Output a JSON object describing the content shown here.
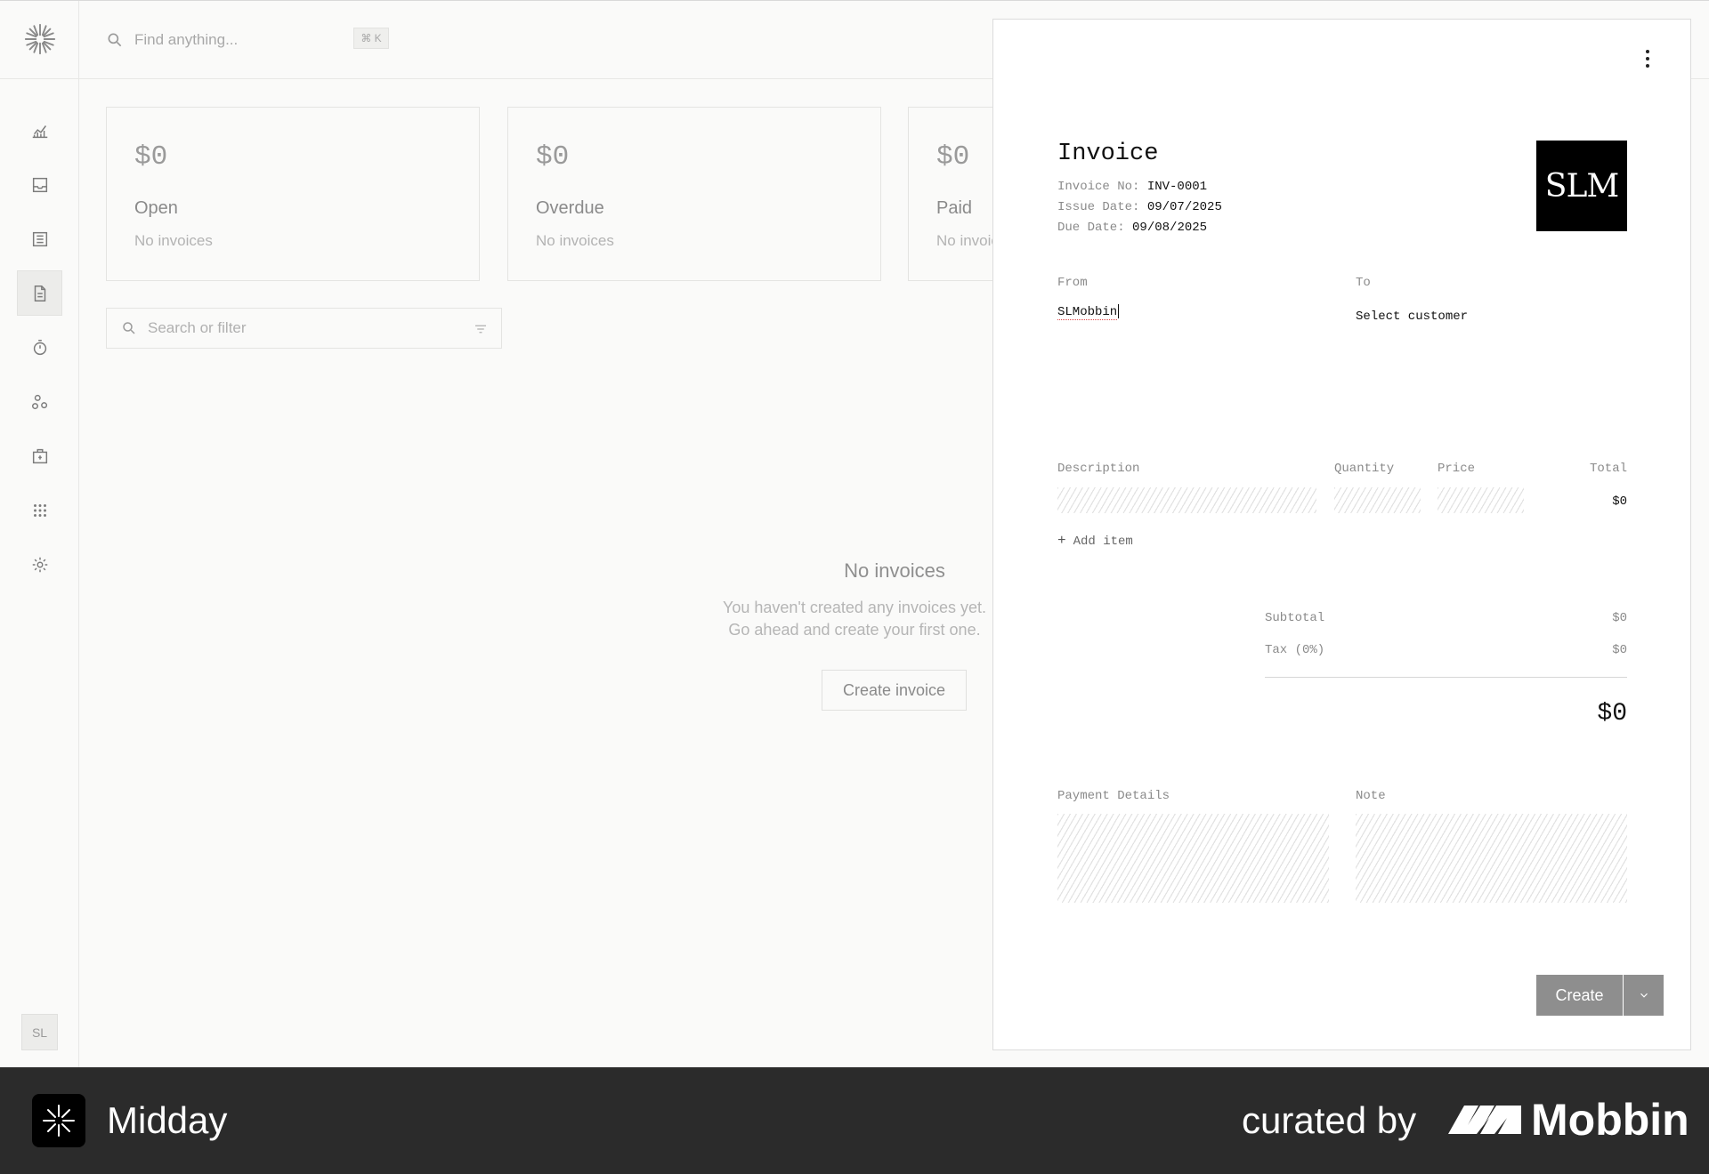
{
  "header": {
    "search_placeholder": "Find anything...",
    "shortcut": "⌘ K"
  },
  "sidebar": {
    "items": [
      {
        "icon": "chart-icon"
      },
      {
        "icon": "inbox-icon"
      },
      {
        "icon": "transactions-icon"
      },
      {
        "icon": "invoice-icon",
        "active": true
      },
      {
        "icon": "timer-icon"
      },
      {
        "icon": "customers-icon"
      },
      {
        "icon": "vault-icon"
      },
      {
        "icon": "apps-icon"
      },
      {
        "icon": "settings-icon"
      }
    ],
    "avatar": "SL"
  },
  "summary_cards": [
    {
      "amount": "$0",
      "label": "Open",
      "sub": "No invoices"
    },
    {
      "amount": "$0",
      "label": "Overdue",
      "sub": "No invoices"
    },
    {
      "amount": "$0",
      "label": "Paid",
      "sub": "No invoices"
    }
  ],
  "filter": {
    "placeholder": "Search or filter"
  },
  "empty_state": {
    "title": "No invoices",
    "line1": "You haven't created any invoices yet.",
    "line2": "Go ahead and create your first one.",
    "button": "Create invoice"
  },
  "invoice": {
    "title": "Invoice",
    "invoice_no_label": "Invoice No:",
    "invoice_no": "INV-0001",
    "issue_date_label": "Issue Date:",
    "issue_date": "09/07/2025",
    "due_date_label": "Due Date:",
    "due_date": "09/08/2025",
    "logo_text": "SLM",
    "from_label": "From",
    "from_value": "SLMobbin",
    "to_label": "To",
    "to_value": "Select customer",
    "columns": {
      "description": "Description",
      "quantity": "Quantity",
      "price": "Price",
      "total": "Total"
    },
    "line_total": "$0",
    "add_item": "Add item",
    "subtotal_label": "Subtotal",
    "subtotal": "$0",
    "tax_label": "Tax (0%)",
    "tax": "$0",
    "grand_total": "$0",
    "payment_details_label": "Payment Details",
    "note_label": "Note",
    "create_button": "Create"
  },
  "footer": {
    "app_name": "Midday",
    "curated_by": "curated by",
    "brand": "Mobbin"
  }
}
